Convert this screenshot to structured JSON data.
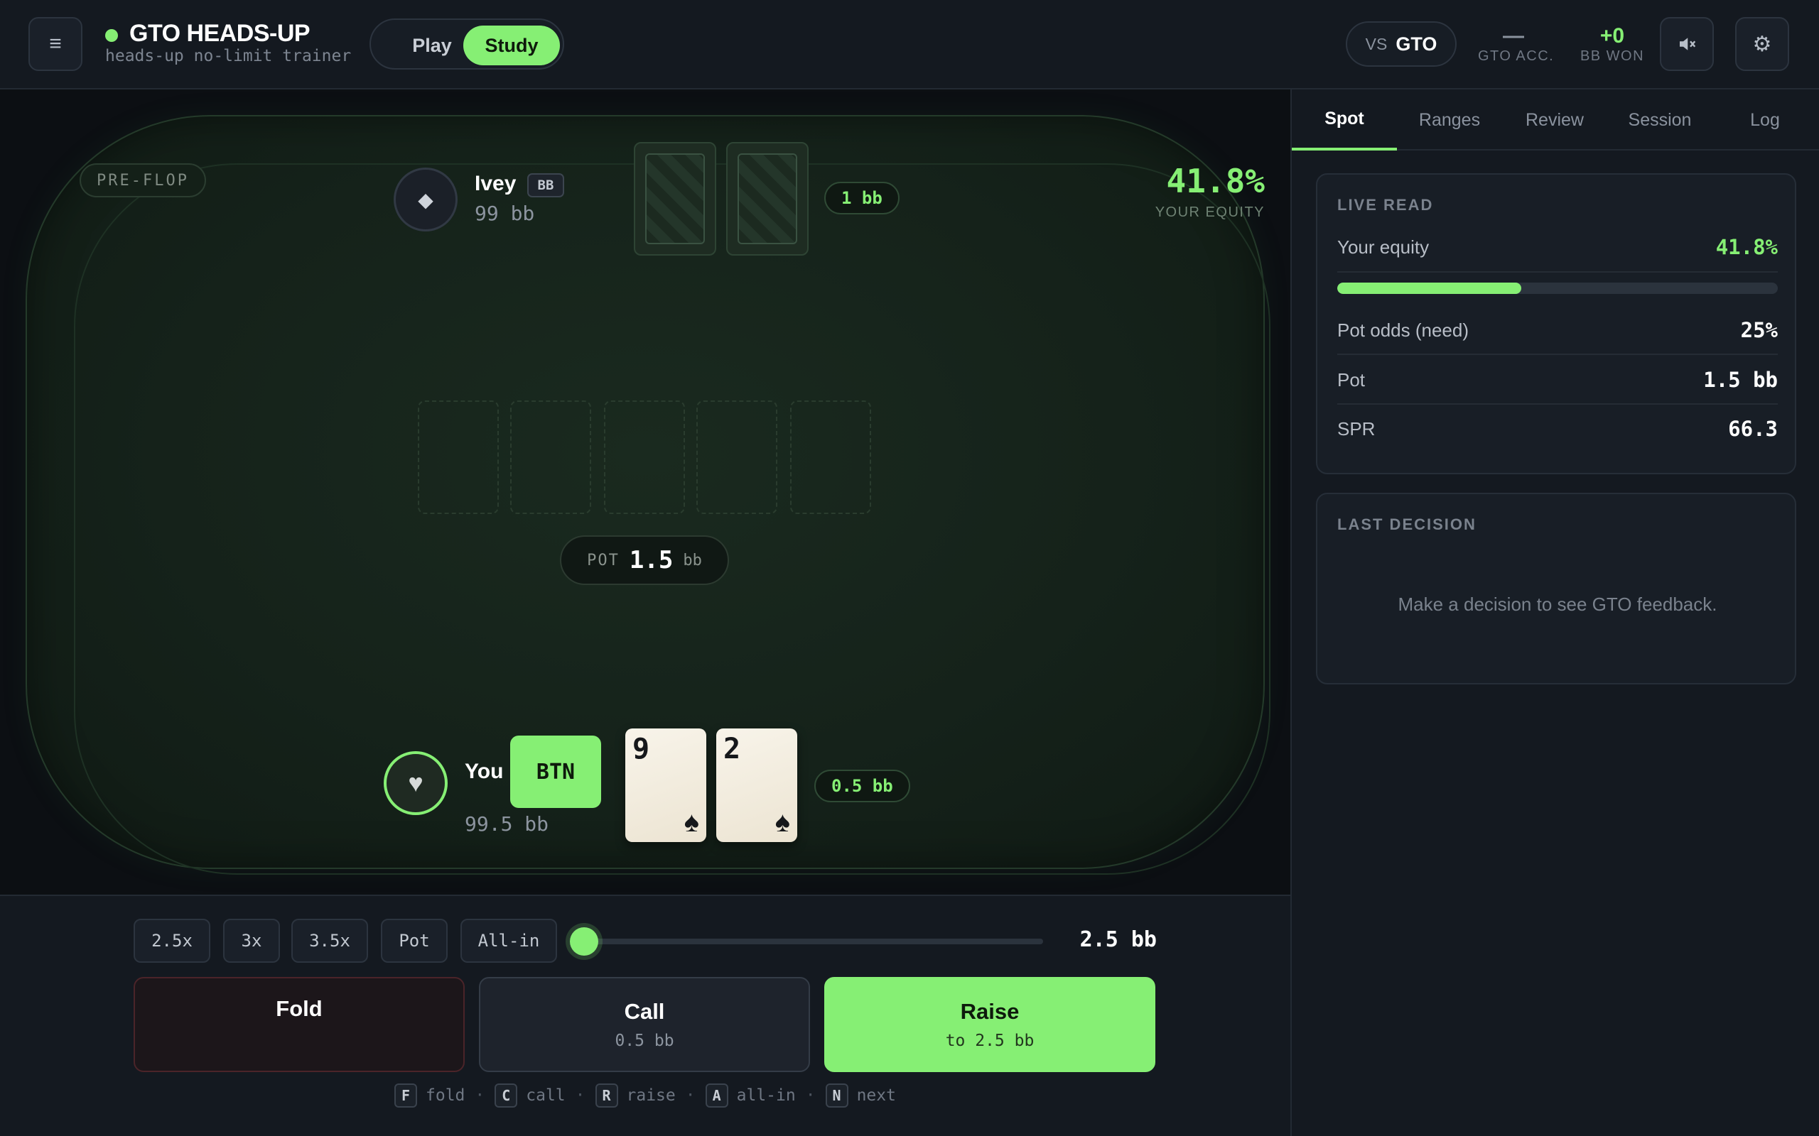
{
  "header": {
    "menu_icon": "hamburger-icon",
    "title": "GTO HEADS-UP",
    "subtitle": "heads-up no-limit trainer",
    "modes": {
      "play": "Play",
      "study": "Study",
      "selected": "Study"
    },
    "opponent": {
      "vs_label": "VS",
      "value": "GTO"
    },
    "gto_acc": {
      "value": "—",
      "label": "GTO ACC."
    },
    "bb_won": {
      "value": "+0",
      "label": "BB WON"
    },
    "sound_icon": "sound-muted-icon",
    "settings_icon": "gear-icon"
  },
  "table": {
    "street": "PRE-FLOP",
    "equity": {
      "value": "41.8%",
      "label": "YOUR EQUITY"
    },
    "opponent": {
      "name": "Ivey",
      "position": "BB",
      "stack": "99 bb",
      "bet": "1 bb",
      "avatar_icon": "diamond-icon"
    },
    "board_cards": [],
    "pot": {
      "label": "POT",
      "value": "1.5",
      "unit": "bb"
    },
    "hero": {
      "name": "You",
      "position": "BTN",
      "stack": "99.5 bb",
      "bet": "0.5 bb",
      "avatar_icon": "heart-icon",
      "cards": [
        {
          "rank": "9",
          "suit": "♠"
        },
        {
          "rank": "2",
          "suit": "♠"
        }
      ]
    }
  },
  "actions": {
    "sizes": [
      "2.5x",
      "3x",
      "3.5x",
      "Pot",
      "All-in"
    ],
    "slider": {
      "value": "2.5 bb",
      "fraction": 0
    },
    "fold": {
      "label": "Fold"
    },
    "call": {
      "label": "Call",
      "amount": "0.5 bb"
    },
    "raise": {
      "label": "Raise",
      "amount": "to 2.5 bb"
    },
    "shortcuts": [
      {
        "key": "F",
        "label": "fold"
      },
      {
        "key": "C",
        "label": "call"
      },
      {
        "key": "R",
        "label": "raise"
      },
      {
        "key": "A",
        "label": "all-in"
      },
      {
        "key": "N",
        "label": "next"
      }
    ],
    "separator": "·"
  },
  "side_panel": {
    "tabs": [
      "Spot",
      "Ranges",
      "Review",
      "Session",
      "Log"
    ],
    "active_tab": "Spot",
    "live_read": {
      "heading": "LIVE READ",
      "equity_label": "Your equity",
      "equity_value": "41.8%",
      "equity_fraction": 0.418,
      "pot_odds_label": "Pot odds (need)",
      "pot_odds_value": "25%",
      "pot_label": "Pot",
      "pot_value": "1.5 bb",
      "spr_label": "SPR",
      "spr_value": "66.3"
    },
    "last_decision": {
      "heading": "LAST DECISION",
      "message": "Make a decision to see GTO feedback."
    }
  },
  "colors": {
    "accent": "#86ef74",
    "background": "#12161d",
    "felt": "#15221a",
    "fold_border": "#4b2429"
  }
}
